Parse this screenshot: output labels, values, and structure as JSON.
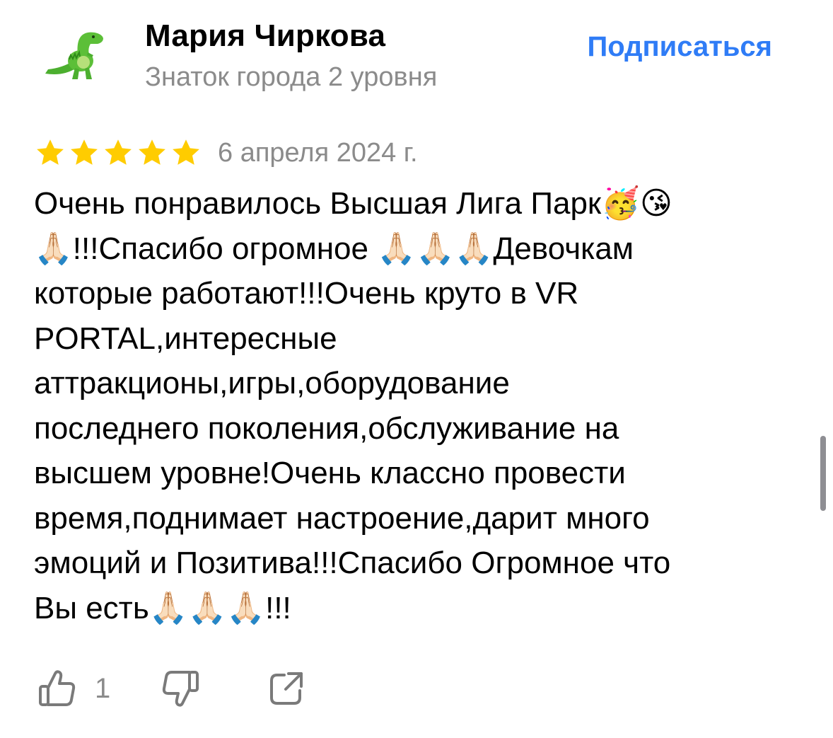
{
  "author": {
    "avatar_icon": "dinosaur-icon",
    "name": "Мария Чиркова",
    "level": "Знаток города 2 уровня"
  },
  "subscribe_label": "Подписаться",
  "review": {
    "rating": 5,
    "max_rating": 5,
    "date": "6 апреля 2024 г.",
    "lines": [
      "Очень понравилось Высшая Лига Парк🥳😘",
      "🙏🏻!!!Спасибо огромное 🙏🏻🙏🏻🙏🏻Девочкам",
      "которые работают!!!Очень круто в VR",
      "PORTAL,интересные",
      "аттракционы,игры,оборудование",
      "последнего поколения,обслуживание на",
      "высшем уровне!Очень классно провести",
      "время,поднимает настроение,дарит много",
      "эмоций и Позитива!!!Спасибо Огромное что",
      "Вы есть🙏🏻🙏🏻🙏🏻!!!"
    ]
  },
  "actions": {
    "like_icon": "thumbs-up-icon",
    "like_count": "1",
    "dislike_icon": "thumbs-down-icon",
    "share_icon": "share-icon"
  },
  "colors": {
    "accent": "#2f7cf6",
    "star": "#ffcc00",
    "secondary_text": "#8b8b8b",
    "icon": "#7a7a7a"
  }
}
